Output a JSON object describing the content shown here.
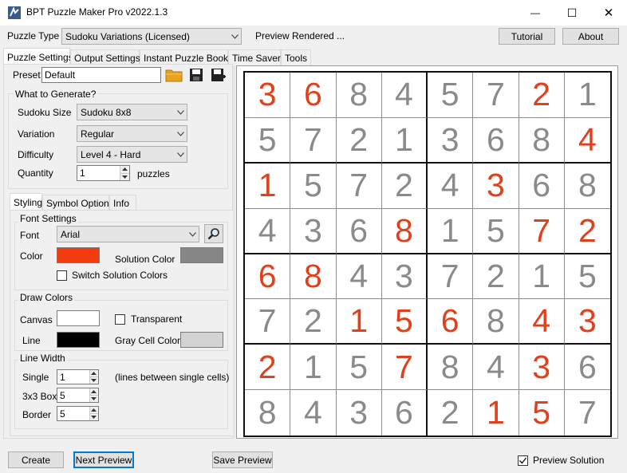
{
  "window": {
    "title": "BPT Puzzle Maker Pro v2022.1.3",
    "controls": {
      "minimize": "—",
      "maximize": "☐",
      "close": "✕"
    }
  },
  "toolbar": {
    "puzzle_type_label": "Puzzle Type",
    "puzzle_type_value": "Sudoku Variations (Licensed)",
    "status": "Preview Rendered ...",
    "tutorial_label": "Tutorial",
    "about_label": "About"
  },
  "main_tabs": [
    "Puzzle Settings",
    "Output Settings",
    "Instant Puzzle Books",
    "Time Saver",
    "Tools"
  ],
  "preset": {
    "label": "Preset",
    "value": "Default"
  },
  "generate": {
    "title": "What to Generate?",
    "size_label": "Sudoku Size",
    "size_value": "Sudoku  8x8",
    "variation_label": "Variation",
    "variation_value": "Regular",
    "difficulty_label": "Difficulty",
    "difficulty_value": "Level 4 - Hard",
    "quantity_label": "Quantity",
    "quantity_value": "1",
    "quantity_unit": "puzzles"
  },
  "sub_tabs": [
    "Styling",
    "Symbol Options",
    "Info"
  ],
  "font_settings": {
    "title": "Font Settings",
    "font_label": "Font",
    "font_value": "Arial",
    "color_label": "Color",
    "color_value": "#f33b12",
    "solution_color_label": "Solution Color",
    "solution_color_value": "#868686",
    "switch_label": "Switch Solution Colors",
    "switch_checked": false
  },
  "draw_colors": {
    "title": "Draw Colors",
    "canvas_label": "Canvas",
    "canvas_color": "#ffffff",
    "transparent_label": "Transparent",
    "transparent_checked": false,
    "line_label": "Line",
    "line_color": "#000000",
    "gray_label": "Gray Cell Color",
    "gray_color": "#d3d3d3"
  },
  "line_width": {
    "title": "Line Width",
    "single_label": "Single",
    "single_value": "1",
    "note": "(lines between single cells)",
    "box_label": "3x3 Box",
    "box_value": "5",
    "border_label": "Border",
    "border_value": "5"
  },
  "bottom": {
    "create_label": "Create",
    "next_label": "Next Preview",
    "save_label": "Save Preview",
    "preview_solution_label": "Preview Solution",
    "preview_solution_checked": true
  },
  "sudoku": {
    "given_color": "#8a8a8a",
    "solution_color": "#e0401c",
    "rows": [
      [
        3,
        6,
        8,
        4,
        5,
        7,
        2,
        1
      ],
      [
        5,
        7,
        2,
        1,
        3,
        6,
        8,
        4
      ],
      [
        1,
        5,
        7,
        2,
        4,
        3,
        6,
        8
      ],
      [
        4,
        3,
        6,
        8,
        1,
        5,
        7,
        2
      ],
      [
        6,
        8,
        4,
        3,
        7,
        2,
        1,
        5
      ],
      [
        7,
        2,
        1,
        5,
        6,
        8,
        4,
        3
      ],
      [
        2,
        1,
        5,
        7,
        8,
        4,
        3,
        6
      ],
      [
        8,
        4,
        3,
        6,
        2,
        1,
        5,
        7
      ]
    ],
    "solution_mask": [
      [
        1,
        1,
        0,
        0,
        0,
        0,
        1,
        0
      ],
      [
        0,
        0,
        0,
        0,
        0,
        0,
        0,
        1
      ],
      [
        1,
        0,
        0,
        0,
        0,
        1,
        0,
        0
      ],
      [
        0,
        0,
        0,
        1,
        0,
        0,
        1,
        1
      ],
      [
        1,
        1,
        0,
        0,
        0,
        0,
        0,
        0
      ],
      [
        0,
        0,
        1,
        1,
        1,
        0,
        1,
        1
      ],
      [
        1,
        0,
        0,
        1,
        0,
        0,
        1,
        0
      ],
      [
        0,
        0,
        0,
        0,
        0,
        1,
        1,
        0
      ]
    ]
  }
}
